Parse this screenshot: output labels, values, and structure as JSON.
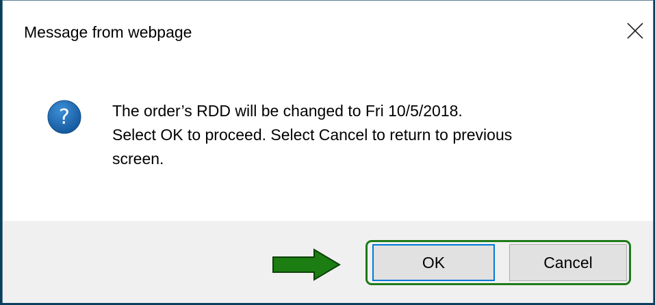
{
  "dialog": {
    "title": "Message from webpage",
    "close_icon": "close-icon",
    "icon": "question-icon",
    "icon_glyph": "?",
    "message_lines": [
      "The order’s RDD will be changed to Fri 10/5/2018.",
      "Select OK to proceed.  Select Cancel to return to previous",
      "screen."
    ]
  },
  "buttons": {
    "ok_label": "OK",
    "cancel_label": "Cancel"
  },
  "annotation": {
    "arrow_icon": "arrow-right-icon",
    "highlight_color": "#1e7a18"
  },
  "colors": {
    "background": "#0a3f5c",
    "dialog_bg": "#ffffff",
    "footer_bg": "#f0f0f0",
    "icon_blue": "#1f6fb8",
    "focus_border": "#0078d7"
  }
}
